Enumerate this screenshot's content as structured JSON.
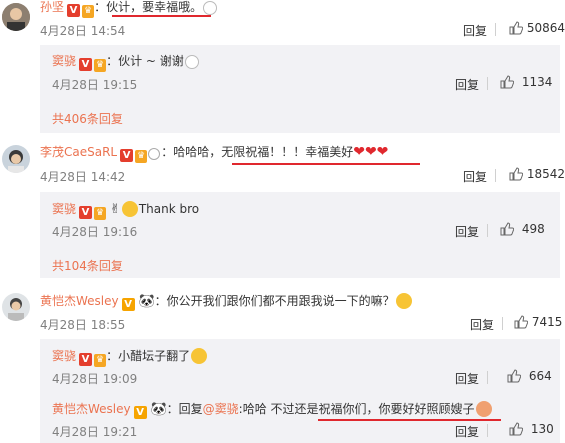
{
  "colors": {
    "name": "#eb7350",
    "underline": "#e0282e",
    "reply_bg": "#f2f2f5"
  },
  "comments": [
    {
      "author": "孙坚",
      "text": "：伙计，要幸福哦。",
      "time": "4月28日 14:54",
      "reply_label": "回复",
      "likes": "50864",
      "replies": [
        {
          "author": "窦骁",
          "text": "：伙计 ~ 谢谢",
          "time": "4月28日 19:15",
          "reply_label": "回复",
          "likes": "1134"
        }
      ],
      "more": "共406条回复"
    },
    {
      "author": "李茂CaeSaRL",
      "text": "：哈哈哈，无限祝福！！！幸福美好",
      "time": "4月28日 14:42",
      "reply_label": "回复",
      "likes": "18542",
      "replies": [
        {
          "author": "窦骁",
          "text": "Thank bro",
          "time": "4月28日 19:16",
          "reply_label": "回复",
          "likes": "498"
        }
      ],
      "more": "共104条回复"
    },
    {
      "author": "黄恺杰Wesley",
      "text": "：你公开我们跟你们都不用跟我说一下的嘛？",
      "time": "4月28日 18:55",
      "reply_label": "回复",
      "likes": "7415",
      "replies": [
        {
          "author": "窦骁",
          "text": "：小醋坛子翻了",
          "time": "4月28日 19:09",
          "reply_label": "回复",
          "likes": "664"
        },
        {
          "author": "黄恺杰Wesley",
          "text_prefix": "：回复",
          "mention": "@窦骁",
          "text": ":哈哈 不过还是祝福你们，你要好好照顾嫂子",
          "time": "4月28日 19:21",
          "reply_label": "回复",
          "likes": "130"
        }
      ]
    }
  ],
  "icons": {
    "like": "thumbs-up-icon",
    "verified": "v-badge-icon",
    "vip": "vip-icon"
  }
}
